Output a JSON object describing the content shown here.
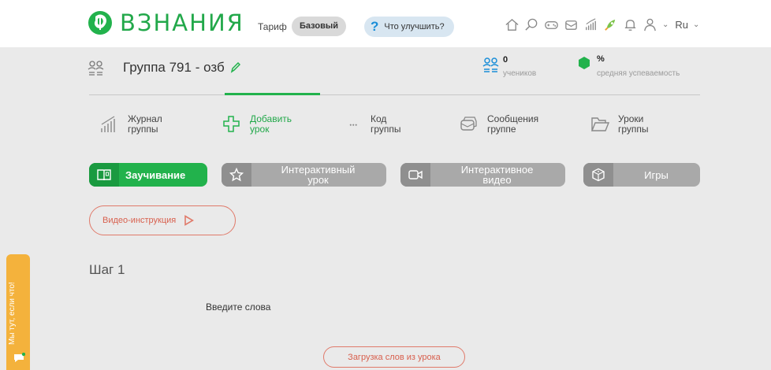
{
  "header": {
    "logo_text": "ВЗНАНИЯ",
    "tariff_label": "Тариф",
    "tariff_value": "Базовый",
    "improve_label": "Что улучшить?",
    "language": "Ru",
    "icons": [
      "home-icon",
      "search-icon",
      "gamepad-icon",
      "mail-icon",
      "stats-icon",
      "rocket-icon",
      "bell-icon",
      "profile-icon"
    ]
  },
  "group": {
    "title": "Группа 791 - озб",
    "students_count": "0",
    "students_label": "учеников",
    "performance_value": "%",
    "performance_label": "средняя успеваемость"
  },
  "menu": [
    {
      "label": "Журнал\nгруппы",
      "icon": "journal-icon"
    },
    {
      "label": "Добавить\nурок",
      "icon": "add-lesson-icon",
      "active": true
    },
    {
      "label": "Код\nгруппы",
      "icon": "code-icon"
    },
    {
      "label": "Сообщения\nгруппе",
      "icon": "messages-icon"
    },
    {
      "label": "Уроки\nгруппы",
      "icon": "folder-icon"
    }
  ],
  "lesson_types": [
    {
      "label": "Заучивание",
      "icon": "book-icon",
      "active": true
    },
    {
      "label": "Интерактивный\nурок",
      "icon": "star-icon"
    },
    {
      "label": "Интерактивное\nвидео",
      "icon": "video-icon"
    },
    {
      "label": "Игры",
      "icon": "dice-icon"
    }
  ],
  "video_instruction": "Видео-инструкция",
  "step_label": "Шаг 1",
  "enter_words": "Введите слова",
  "load_words_button": "Загрузка слов из урока",
  "side_feedback": "Мы тут, если что!",
  "colors": {
    "brand_green": "#22b24c",
    "accent_red": "#e07a6a",
    "tab_gray": "#a9a9a9",
    "side_orange": "#f4b23c",
    "improve_blue": "#1a8ed8"
  }
}
